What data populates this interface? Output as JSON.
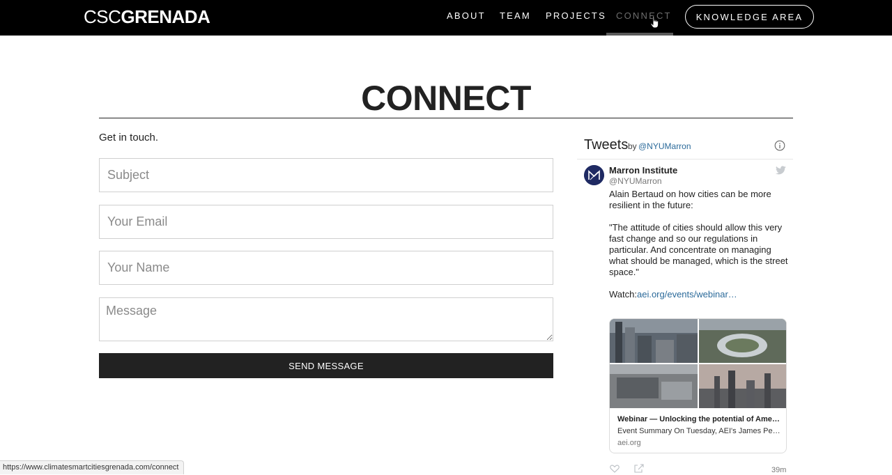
{
  "header": {
    "logo_light": "CSC",
    "logo_bold": "GRENADA",
    "nav": [
      "ABOUT",
      "TEAM",
      "PROJECTS",
      "CONNECT"
    ],
    "active_nav": "CONNECT",
    "knowledge_button": "KNOWLEDGE AREA"
  },
  "main": {
    "title": "CONNECT",
    "intro": "Get in touch.",
    "form": {
      "subject_placeholder": "Subject",
      "email_placeholder": "Your Email",
      "name_placeholder": "Your Name",
      "message_placeholder": "Message",
      "submit_label": "SEND MESSAGE"
    }
  },
  "twitter": {
    "title": "Tweets",
    "by": "by",
    "handle_link": "@NYUMarron",
    "tweet": {
      "author_name": "Marron Institute",
      "author_handle": "@NYUMarron",
      "text_1": "Alain Bertaud on how cities can be more resilient in the future:",
      "text_2": "\"The attitude of cities should allow this very fast change and so our regulations in particular. And concentrate on managing what should be managed, which is the street space.\"",
      "watch_prefix": "Watch:",
      "watch_link": "aei.org/events/webinar…",
      "time": "39m"
    },
    "card": {
      "title": "Webinar — Unlocking the potential of Amer…",
      "description": "Event Summary On Tuesday, AEI's James Pet…",
      "domain": "aei.org"
    }
  },
  "statusbar": {
    "url": "https://www.climatesmartcitiesgrenada.com/connect"
  },
  "colors": {
    "header_bg": "#000000",
    "link_blue": "#2b6a9a",
    "button_dark": "#222222",
    "active_nav": "#6e6e6e"
  }
}
